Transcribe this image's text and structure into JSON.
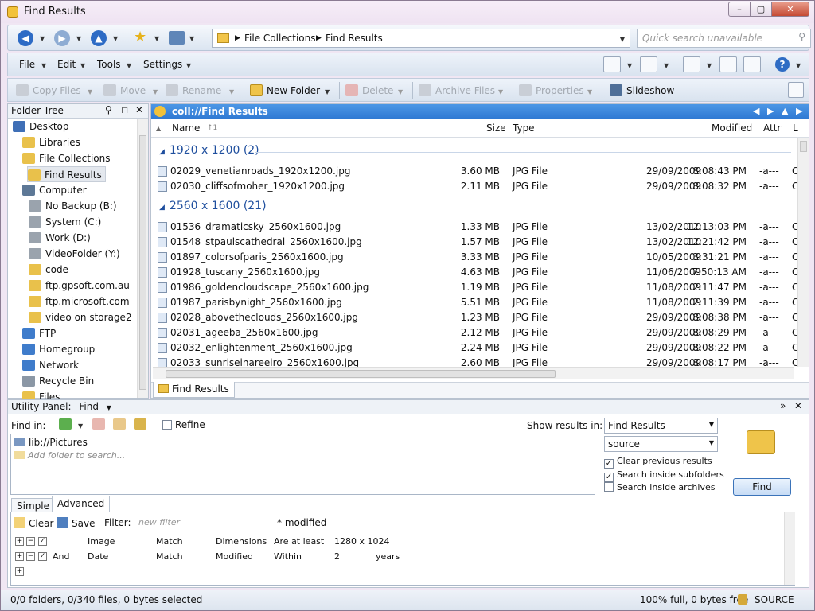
{
  "window": {
    "title": "Find Results",
    "min_label": "–",
    "max_label": "▢",
    "close_label": "✕"
  },
  "address": {
    "crumbs": [
      "File Collections",
      "Find Results"
    ],
    "search_placeholder": "Quick search unavailable"
  },
  "menu": {
    "items": [
      "File",
      "Edit",
      "Tools",
      "Settings"
    ]
  },
  "toolbar": {
    "copy": "Copy Files",
    "move": "Move",
    "rename": "Rename",
    "new_folder": "New Folder",
    "delete": "Delete",
    "archive": "Archive Files",
    "properties": "Properties",
    "slideshow": "Slideshow"
  },
  "folder_tree": {
    "title": "Folder Tree",
    "items": [
      {
        "label": "Desktop",
        "color": "#3f6fb6"
      },
      {
        "label": "Libraries",
        "color": "#e9c14b"
      },
      {
        "label": "File Collections",
        "color": "#e9c14b"
      },
      {
        "label": "Find Results",
        "color": "#e9c14b",
        "selected": true
      },
      {
        "label": "Computer",
        "color": "#5d7896"
      },
      {
        "label": "No Backup (B:)",
        "color": "#9aa3ad"
      },
      {
        "label": "System (C:)",
        "color": "#9aa3ad"
      },
      {
        "label": "Work (D:)",
        "color": "#9aa3ad"
      },
      {
        "label": "VideoFolder (Y:)",
        "color": "#9aa3ad"
      },
      {
        "label": "code",
        "color": "#e9c14b"
      },
      {
        "label": "ftp.gpsoft.com.au",
        "color": "#e9c14b"
      },
      {
        "label": "ftp.microsoft.com",
        "color": "#e9c14b"
      },
      {
        "label": "video on storage2",
        "color": "#e9c14b"
      },
      {
        "label": "FTP",
        "color": "#3f7ccb"
      },
      {
        "label": "Homegroup",
        "color": "#3f7ccb"
      },
      {
        "label": "Network",
        "color": "#3f7ccb"
      },
      {
        "label": "Recycle Bin",
        "color": "#8b97a5"
      },
      {
        "label": "Files",
        "color": "#e9c14b"
      }
    ]
  },
  "lister": {
    "path": "coll://Find Results",
    "columns": {
      "name": "Name",
      "size": "Size",
      "type": "Type",
      "modified": "Modified",
      "attr": "Attr",
      "extra": "L"
    },
    "groups": [
      {
        "title": "1920 x 1200 (2)",
        "files": [
          {
            "name": "02029_venetianroads_1920x1200.jpg",
            "size": "3.60 MB",
            "type": "JPG File",
            "date": "29/09/2009",
            "time": "8:08:43 PM",
            "attr": "-a---",
            "extra": "C"
          },
          {
            "name": "02030_cliffsofmoher_1920x1200.jpg",
            "size": "2.11 MB",
            "type": "JPG File",
            "date": "29/09/2009",
            "time": "8:08:32 PM",
            "attr": "-a---",
            "extra": "C"
          }
        ]
      },
      {
        "title": "2560 x 1600 (21)",
        "files": [
          {
            "name": "01536_dramaticsky_2560x1600.jpg",
            "size": "1.33 MB",
            "type": "JPG File",
            "date": "13/02/2010",
            "time": "12:13:03 PM",
            "attr": "-a---",
            "extra": "C"
          },
          {
            "name": "01548_stpaulscathedral_2560x1600.jpg",
            "size": "1.57 MB",
            "type": "JPG File",
            "date": "13/02/2010",
            "time": "12:21:42 PM",
            "attr": "-a---",
            "extra": "C"
          },
          {
            "name": "01897_colorsofparis_2560x1600.jpg",
            "size": "3.33 MB",
            "type": "JPG File",
            "date": "10/05/2009",
            "time": "3:31:21 PM",
            "attr": "-a---",
            "extra": "C"
          },
          {
            "name": "01928_tuscany_2560x1600.jpg",
            "size": "4.63 MB",
            "type": "JPG File",
            "date": "11/06/2009",
            "time": "7:50:13 AM",
            "attr": "-a---",
            "extra": "C"
          },
          {
            "name": "01986_goldencloudscape_2560x1600.jpg",
            "size": "1.19 MB",
            "type": "JPG File",
            "date": "11/08/2009",
            "time": "2:11:47 PM",
            "attr": "-a---",
            "extra": "C"
          },
          {
            "name": "01987_parisbynight_2560x1600.jpg",
            "size": "5.51 MB",
            "type": "JPG File",
            "date": "11/08/2009",
            "time": "2:11:39 PM",
            "attr": "-a---",
            "extra": "C"
          },
          {
            "name": "02028_abovetheclouds_2560x1600.jpg",
            "size": "1.23 MB",
            "type": "JPG File",
            "date": "29/09/2009",
            "time": "8:08:38 PM",
            "attr": "-a---",
            "extra": "C"
          },
          {
            "name": "02031_ageeba_2560x1600.jpg",
            "size": "2.12 MB",
            "type": "JPG File",
            "date": "29/09/2009",
            "time": "8:08:29 PM",
            "attr": "-a---",
            "extra": "C"
          },
          {
            "name": "02032_enlightenment_2560x1600.jpg",
            "size": "2.24 MB",
            "type": "JPG File",
            "date": "29/09/2009",
            "time": "8:08:22 PM",
            "attr": "-a---",
            "extra": "C"
          },
          {
            "name": "02033_sunriseinareeiro_2560x1600.jpg",
            "size": "2.60 MB",
            "type": "JPG File",
            "date": "29/09/2009",
            "time": "8:08:17 PM",
            "attr": "-a---",
            "extra": "C"
          }
        ]
      }
    ],
    "tab_label": "Find Results"
  },
  "utility": {
    "title": "Utility Panel:",
    "mode": "Find",
    "find_in": "Find in:",
    "refine": "Refine",
    "show_results_in": "Show results in:",
    "results_target": "Find Results",
    "source": "source",
    "locations": [
      "lib://Pictures"
    ],
    "add_folder_placeholder": "Add folder to search...",
    "opt_clear": "Clear previous results",
    "opt_subfolders": "Search inside subfolders",
    "opt_archives": "Search inside archives",
    "find_button": "Find",
    "tabs": [
      "Simple",
      "Advanced"
    ],
    "clear": "Clear",
    "save": "Save",
    "filter_label": "Filter:",
    "filter_placeholder": "new filter",
    "modified_flag": "* modified",
    "rules": [
      {
        "op": "",
        "field": "Image",
        "match": "Match",
        "sub": "Dimensions",
        "cond": "Are at least",
        "value": "1280 x 1024",
        "unit": ""
      },
      {
        "op": "And",
        "field": "Date",
        "match": "Match",
        "sub": "Modified",
        "cond": "Within",
        "value": "2",
        "unit": "years"
      }
    ]
  },
  "status": {
    "left": "0/0 folders, 0/340 files, 0 bytes selected",
    "right": "100% full, 0 bytes free",
    "source": "SOURCE"
  }
}
